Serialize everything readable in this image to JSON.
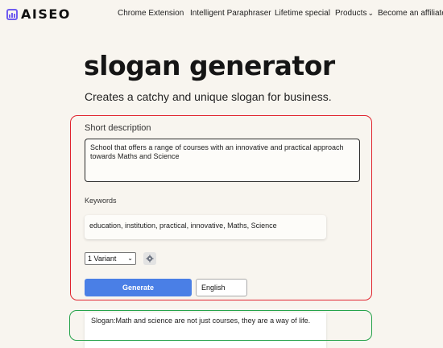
{
  "brand": {
    "name": "AISEO"
  },
  "nav": {
    "items": [
      {
        "label": "Chrome Extension"
      },
      {
        "label": "Intelligent Paraphraser"
      },
      {
        "label": "Lifetime special"
      },
      {
        "label": "Products",
        "has_dropdown": true
      },
      {
        "label": "Become an affiliate"
      }
    ]
  },
  "page": {
    "title": "slogan generator",
    "subtitle": "Creates a catchy and unique slogan for business."
  },
  "form": {
    "description_label": "Short description",
    "description_value": "School that offers a range of courses with an innovative and practical approach towards Maths and Science",
    "keywords_label": "Keywords",
    "keywords_value": "education, institution, practical, innovative, Maths, Science",
    "variant_selected": "1 Variant",
    "generate_label": "Generate",
    "language_value": "English"
  },
  "result": {
    "text": "Slogan:Math and science are not just courses, they are a way of life."
  },
  "colors": {
    "background": "#f8f5ef",
    "accent": "#4a7fe6",
    "brand": "#6f5cf0",
    "highlight_red": "#e0242e",
    "highlight_green": "#25a24a"
  }
}
